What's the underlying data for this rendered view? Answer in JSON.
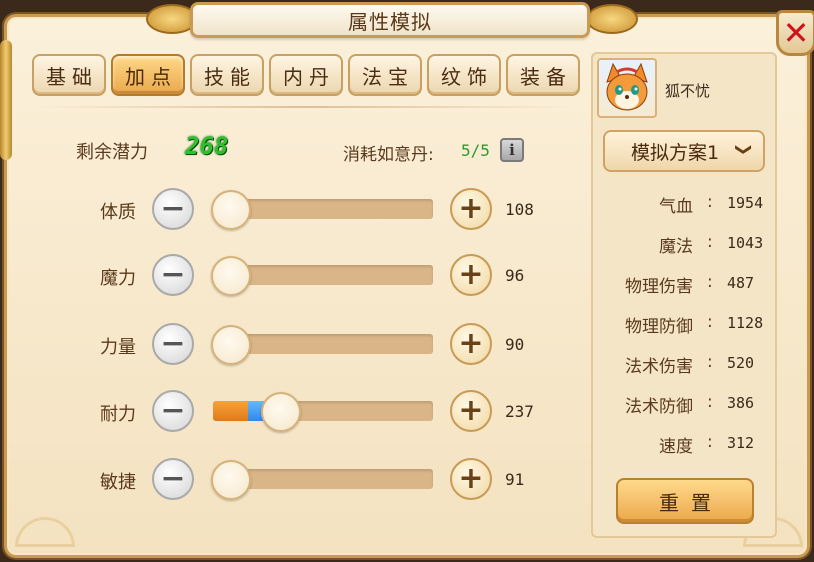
{
  "window": {
    "title": "属性模拟",
    "close_symbol": "✕"
  },
  "tabs": [
    {
      "label": "基础",
      "active": false
    },
    {
      "label": "加点",
      "active": true
    },
    {
      "label": "技能",
      "active": false
    },
    {
      "label": "内丹",
      "active": false
    },
    {
      "label": "法宝",
      "active": false
    },
    {
      "label": "纹饰",
      "active": false
    },
    {
      "label": "装备",
      "active": false
    }
  ],
  "potential": {
    "label": "剩余潜力",
    "value": "268"
  },
  "pill": {
    "label": "消耗如意丹:",
    "value": "5/5",
    "info_icon": "i"
  },
  "stats": [
    {
      "name": "体质",
      "value": "108",
      "base_fraction": 0.08,
      "added_fraction": 0.0
    },
    {
      "name": "魔力",
      "value": "96",
      "base_fraction": 0.07,
      "added_fraction": 0.0
    },
    {
      "name": "力量",
      "value": "90",
      "base_fraction": 0.06,
      "added_fraction": 0.0
    },
    {
      "name": "耐力",
      "value": "237",
      "base_fraction": 0.16,
      "added_fraction": 0.15
    },
    {
      "name": "敏捷",
      "value": "91",
      "base_fraction": 0.06,
      "added_fraction": 0.0
    }
  ],
  "controls": {
    "minus_symbol": "−",
    "plus_symbol": "+"
  },
  "character": {
    "name": "狐不忧"
  },
  "plan": {
    "label": "模拟方案1",
    "chevron": "❯"
  },
  "attributes": [
    {
      "label": "气血",
      "colon": ":",
      "value": "1954"
    },
    {
      "label": "魔法",
      "colon": ":",
      "value": "1043"
    },
    {
      "label": "物理伤害",
      "colon": ":",
      "value": "487"
    },
    {
      "label": "物理防御",
      "colon": ":",
      "value": "1128"
    },
    {
      "label": "法术伤害",
      "colon": ":",
      "value": "520"
    },
    {
      "label": "法术防御",
      "colon": ":",
      "value": "386"
    },
    {
      "label": "速度",
      "colon": ":",
      "value": "312"
    }
  ],
  "reset": {
    "label": "重置"
  },
  "colors": {
    "base_fill": "#e88a26",
    "added_fill": "#3d95f0",
    "potential_green": "#2fbf2f",
    "close_red": "#d0121a"
  }
}
